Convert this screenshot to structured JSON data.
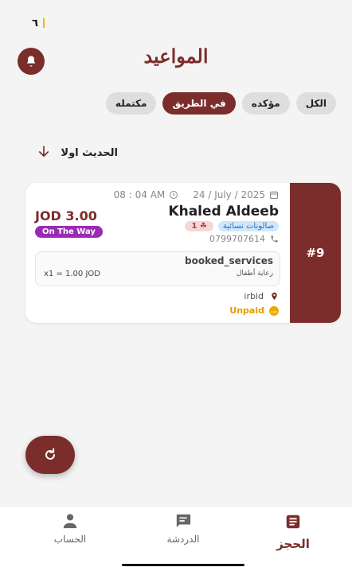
{
  "status_bar": {
    "time": "٦",
    "right_text": ""
  },
  "header": {
    "title": "المواعيد",
    "bell_icon": "bell-icon"
  },
  "filters": [
    {
      "label": "الكل",
      "active": false
    },
    {
      "label": "مؤكده",
      "active": false
    },
    {
      "label": "في الطريق",
      "active": true
    },
    {
      "label": "مكتمله",
      "active": false
    }
  ],
  "sort": {
    "label": "الحديث اولا",
    "icon": "arrow-down-icon"
  },
  "booking": {
    "number": "#9",
    "date": "24 / July / 2025",
    "time": "08 : 04 AM",
    "customer_name": "Khaled Aldeeb",
    "category_tag": "صالونات نسائية",
    "people_tag": "1",
    "phone": "0799707614",
    "price": "JOD 3.00",
    "status": "On The Way",
    "services": {
      "title": "booked_services",
      "service_name": "رعاية أطفال",
      "service_price": "x1 = 1.00 JOD"
    },
    "location": "irbid",
    "payment_status": "Unpaid"
  },
  "fab": {
    "icon": "refresh-icon"
  },
  "bottom_nav": [
    {
      "label": "الحساب",
      "icon": "person-icon",
      "active": false
    },
    {
      "label": "الدردشة",
      "icon": "chat-icon",
      "active": false
    },
    {
      "label": "الحجز",
      "icon": "booking-icon",
      "active": true
    }
  ],
  "colors": {
    "primary": "#7b2d2b",
    "status_purple": "#9a2bb5",
    "unpaid": "#f0a500"
  }
}
